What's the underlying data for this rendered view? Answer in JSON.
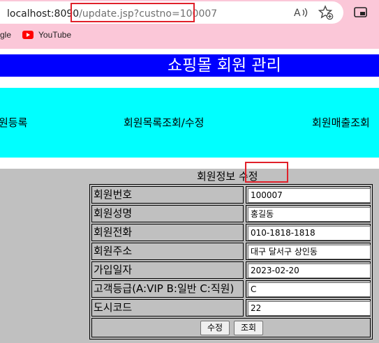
{
  "browser": {
    "url_host": "localhost:8090",
    "url_path": "/update.jsp?custno=100007",
    "bookmarks": [
      {
        "label": "gle"
      },
      {
        "label": "YouTube"
      }
    ],
    "accent_highlight": "#e0202a"
  },
  "page": {
    "banner_title": "쇼핑몰 회원 관리",
    "nav": [
      "원등록",
      "회원목록조회/수정",
      "회원매출조회"
    ],
    "form_title": "회원정보 수정",
    "fields": [
      {
        "label": "회원번호",
        "value": "100007"
      },
      {
        "label": "회원성명",
        "value": "홍길동"
      },
      {
        "label": "회원전화",
        "value": "010-1818-1818"
      },
      {
        "label": "회원주소",
        "value": "대구 달서구 상인동"
      },
      {
        "label": "가입일자",
        "value": "2023-02-20"
      },
      {
        "label": "고객등급(A:VIP B:일반 C:직원)",
        "value": "C"
      },
      {
        "label": "도시코드",
        "value": "22"
      }
    ],
    "buttons": {
      "update": "수정",
      "lookup": "조회"
    },
    "colors": {
      "banner": "#0000ff",
      "nav": "#00ffff",
      "section": "#c0c0c0"
    }
  }
}
